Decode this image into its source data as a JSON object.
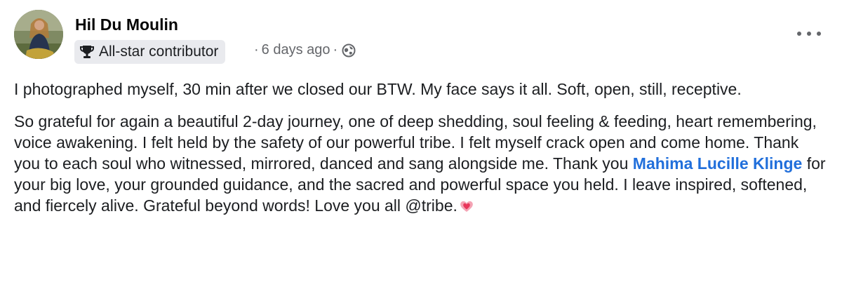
{
  "author": {
    "name": "Hil Du Moulin",
    "badge": "All-star contributor",
    "badge_icon": "trophy-icon"
  },
  "meta": {
    "separator": "·",
    "time": "6 days ago",
    "audience_icon": "globe-icon"
  },
  "menu": {
    "icon": "more-options-icon"
  },
  "post": {
    "paragraph1": "I photographed myself, 30 min after we closed our BTW. My face says it all. Soft, open, still, receptive.",
    "paragraph2_before": "So grateful for again a beautiful 2-day journey, one of deep shedding, soul feeling & feeding, heart remembering, voice awakening. I felt held by the safety of our powerful tribe. I felt myself crack open and come home. Thank you to each soul who witnessed, mirrored, danced and sang alongside me. Thank you ",
    "mention": "Mahima Lucille Klinge",
    "paragraph2_after": " for your big love, your grounded guidance, and the sacred and powerful space you held. I leave inspired, softened, and fiercely alive. Grateful beyond words! Love you all @tribe.",
    "emoji": "heart-emoji"
  },
  "colors": {
    "link": "#216fdb",
    "secondary_text": "#65676b",
    "badge_bg": "#e9eaee"
  }
}
